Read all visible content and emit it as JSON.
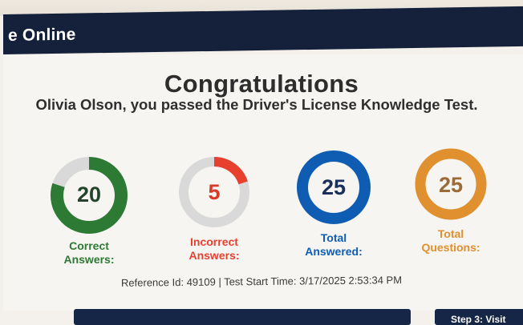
{
  "header": {
    "title": "e Online"
  },
  "main": {
    "title": "Congratulations",
    "subtitle": "Olivia Olson, you passed the Driver's License Knowledge Test.",
    "stats": [
      {
        "value": "20",
        "label": "Correct\nAnswers:",
        "fraction": 0.8,
        "color": "#2c7a33",
        "track": "#d9d9d9"
      },
      {
        "value": "5",
        "label": "Incorrect\nAnswers:",
        "fraction": 0.2,
        "color": "#e8402f",
        "track": "#d9d9d9"
      },
      {
        "value": "25",
        "label": "Total\nAnswered:",
        "fraction": 1.0,
        "color": "#0e5db3",
        "track": "#d9d9d9"
      },
      {
        "value": "25",
        "label": "Total\nQuestions:",
        "fraction": 1.0,
        "color": "#e0902e",
        "track": "#d9d9d9"
      }
    ],
    "reference": "Reference Id: 49109 | Test Start Time: 3/17/2025 2:53:34 PM"
  },
  "footer": {
    "next_button": "Step 3: Visit"
  },
  "colors": {
    "header_bg": "#15213a",
    "correct": "#2c7a33",
    "incorrect": "#e8402f",
    "total_answered": "#0e5db3",
    "total_questions": "#e0902e"
  }
}
